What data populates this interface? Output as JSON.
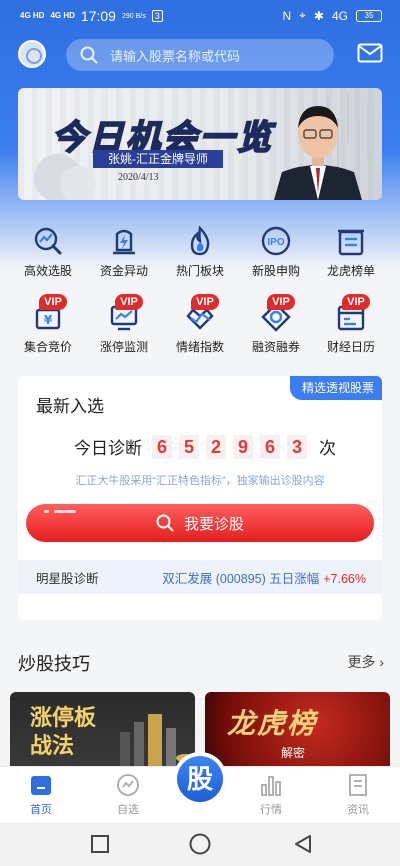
{
  "status": {
    "signal1": "4G HD",
    "signal2": "4G HD",
    "time": "17:09",
    "speed": "290 B/s",
    "badge": "3",
    "net": "4G",
    "battery": "35"
  },
  "search": {
    "placeholder": "请输入股票名称或代码"
  },
  "banner": {
    "title": "今日机会一览",
    "name": "张姚-汇正金牌导师",
    "date": "2020/4/13"
  },
  "features": [
    {
      "label": "高效选股",
      "vip": "",
      "icon": "magnifier-chart-icon"
    },
    {
      "label": "资金异动",
      "vip": "",
      "icon": "lightning-battery-icon"
    },
    {
      "label": "热门板块",
      "vip": "",
      "icon": "flame-icon"
    },
    {
      "label": "新股申购",
      "vip": "",
      "icon": "ipo-icon"
    },
    {
      "label": "龙虎榜单",
      "vip": "",
      "icon": "list-board-icon"
    },
    {
      "label": "集合竞价",
      "vip": "VIP",
      "icon": "yen-basket-icon"
    },
    {
      "label": "涨停监测",
      "vip": "VIP",
      "icon": "monitor-chart-icon"
    },
    {
      "label": "情绪指数",
      "vip": "VIP",
      "icon": "emotion-graph-icon"
    },
    {
      "label": "融资融券",
      "vip": "VIP",
      "icon": "finance-diamond-icon"
    },
    {
      "label": "财经日历",
      "vip": "VIP",
      "icon": "calendar-icon"
    }
  ],
  "card": {
    "title": "最新入选",
    "tag": "精选透视股票",
    "diag_prefix": "今日诊断",
    "digits": [
      "6",
      "5",
      "2",
      "9",
      "6",
      "3"
    ],
    "diag_suffix": "次",
    "desc": "汇正大牛股采用“汇正特色指标”，独家输出诊股内容",
    "button": "我要诊股",
    "star_label": "明星股诊断",
    "star_stock": "双汇发展 (000895)  五日涨幅",
    "star_pct": "+7.66%"
  },
  "tips": {
    "title": "炒股技巧",
    "more": "更多",
    "card1": "涨停板\n战法",
    "card2_title": "龙虎榜",
    "card2_sub": "解密"
  },
  "tabs": [
    {
      "label": "首页",
      "active": true
    },
    {
      "label": "自选",
      "active": false
    },
    {
      "label": "股",
      "active": false
    },
    {
      "label": "行情",
      "active": false
    },
    {
      "label": "资讯",
      "active": false
    }
  ],
  "colors": {
    "primary": "#2f6fe0",
    "accent_red": "#e02b2b"
  }
}
